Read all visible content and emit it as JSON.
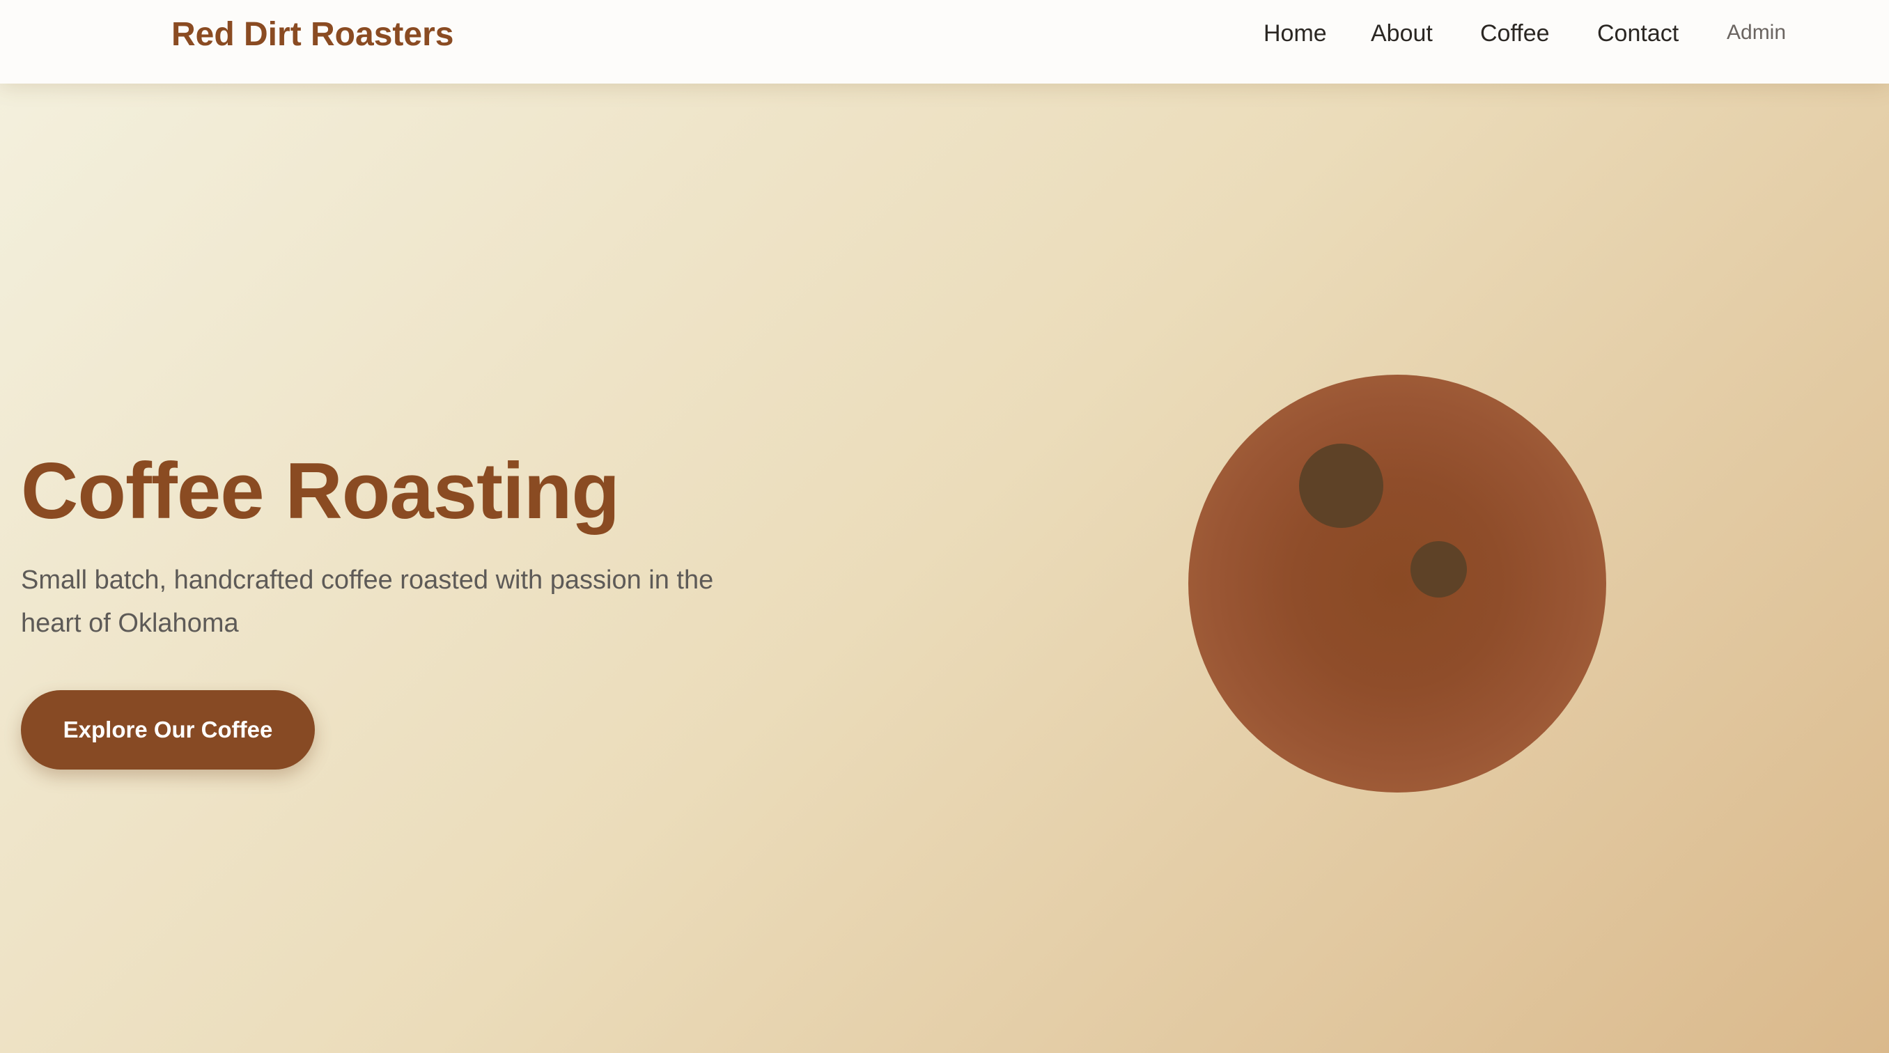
{
  "header": {
    "brand": "Red Dirt Roasters",
    "nav": {
      "home": "Home",
      "about": "About",
      "coffee": "Coffee",
      "contact": "Contact",
      "admin": "Admin"
    }
  },
  "hero": {
    "title": "Coffee Roasting",
    "subtitle": "Small batch, handcrafted coffee roasted with passion in the heart of Oklahoma",
    "cta_label": "Explore Our Coffee",
    "illustration_icon": "coffee-bean-icon"
  },
  "colors": {
    "brand": "#8a4b22",
    "cta_background": "#874a24",
    "bean": "#8f4d2a",
    "bean_spots": "#5e4227",
    "background_start": "#f4f1df",
    "background_end": "#dab98c"
  }
}
